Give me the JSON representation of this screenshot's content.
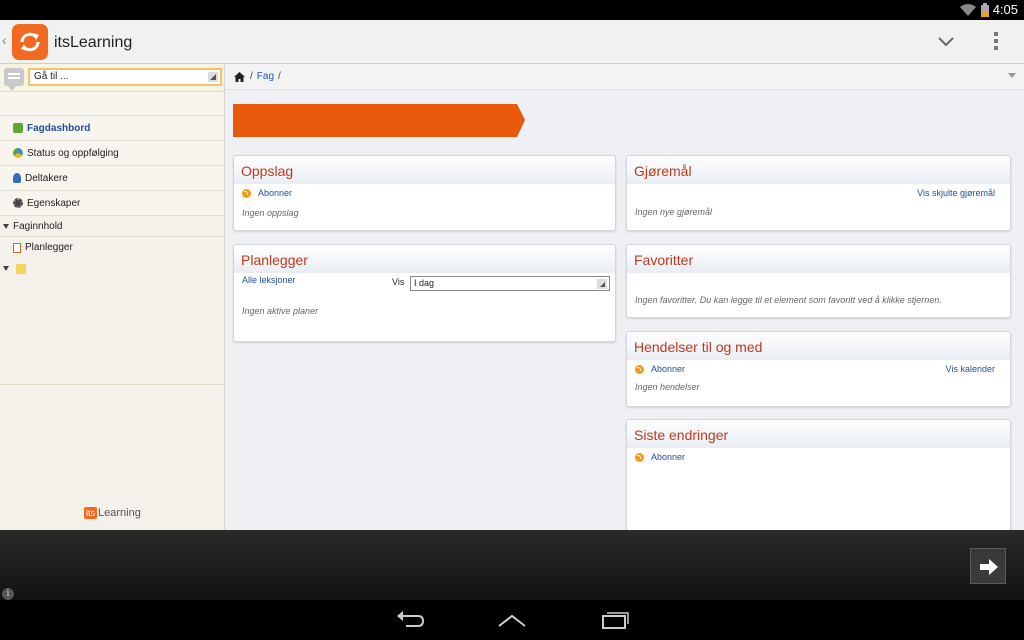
{
  "status_bar": {
    "time": "4:05"
  },
  "app": {
    "title": "itsLearning"
  },
  "sidebar": {
    "goto_placeholder": "Gå til ...",
    "items": [
      {
        "label": "Fagdashbord",
        "icon": "dashboard-icon",
        "color": "#5aa832"
      },
      {
        "label": "Status og oppfølging",
        "icon": "status-icon",
        "color": "#3c8fd6"
      },
      {
        "label": "Deltakere",
        "icon": "person-icon",
        "color": "#2f6fc0"
      },
      {
        "label": "Egenskaper",
        "icon": "gear-icon",
        "color": "#444444"
      }
    ],
    "section_label": "Faginnhold",
    "sub_items": [
      {
        "label": "Planlegger",
        "icon": "planner-icon"
      }
    ],
    "footer_logo": {
      "its": "its",
      "rest": "Learning"
    }
  },
  "breadcrumb": {
    "items": [
      "Fag"
    ]
  },
  "cards": {
    "oppslag": {
      "title": "Oppslag",
      "subscribe": "Abonner",
      "empty": "Ingen oppslag"
    },
    "planlegger": {
      "title": "Planlegger",
      "all_link": "Alle leksjoner",
      "vis_label": "Vis",
      "vis_value": "I dag",
      "empty": "Ingen aktive planer"
    },
    "gjoremal": {
      "title": "Gjøremål",
      "link": "Vis skjulte gjøremål",
      "empty": "Ingen nye gjøremål"
    },
    "favoritter": {
      "title": "Favoritter",
      "empty": "Ingen favoritter. Du kan legge til et element som favoritt ved å klikke stjernen."
    },
    "hendelser": {
      "title": "Hendelser til og med",
      "subscribe": "Abonner",
      "link": "Vis kalender",
      "empty": "Ingen hendelser"
    },
    "siste": {
      "title": "Siste endringer",
      "subscribe": "Abonner"
    }
  },
  "colors": {
    "accent": "#f26a21",
    "title_red": "#c0391b",
    "link_blue": "#1f4e9c"
  }
}
